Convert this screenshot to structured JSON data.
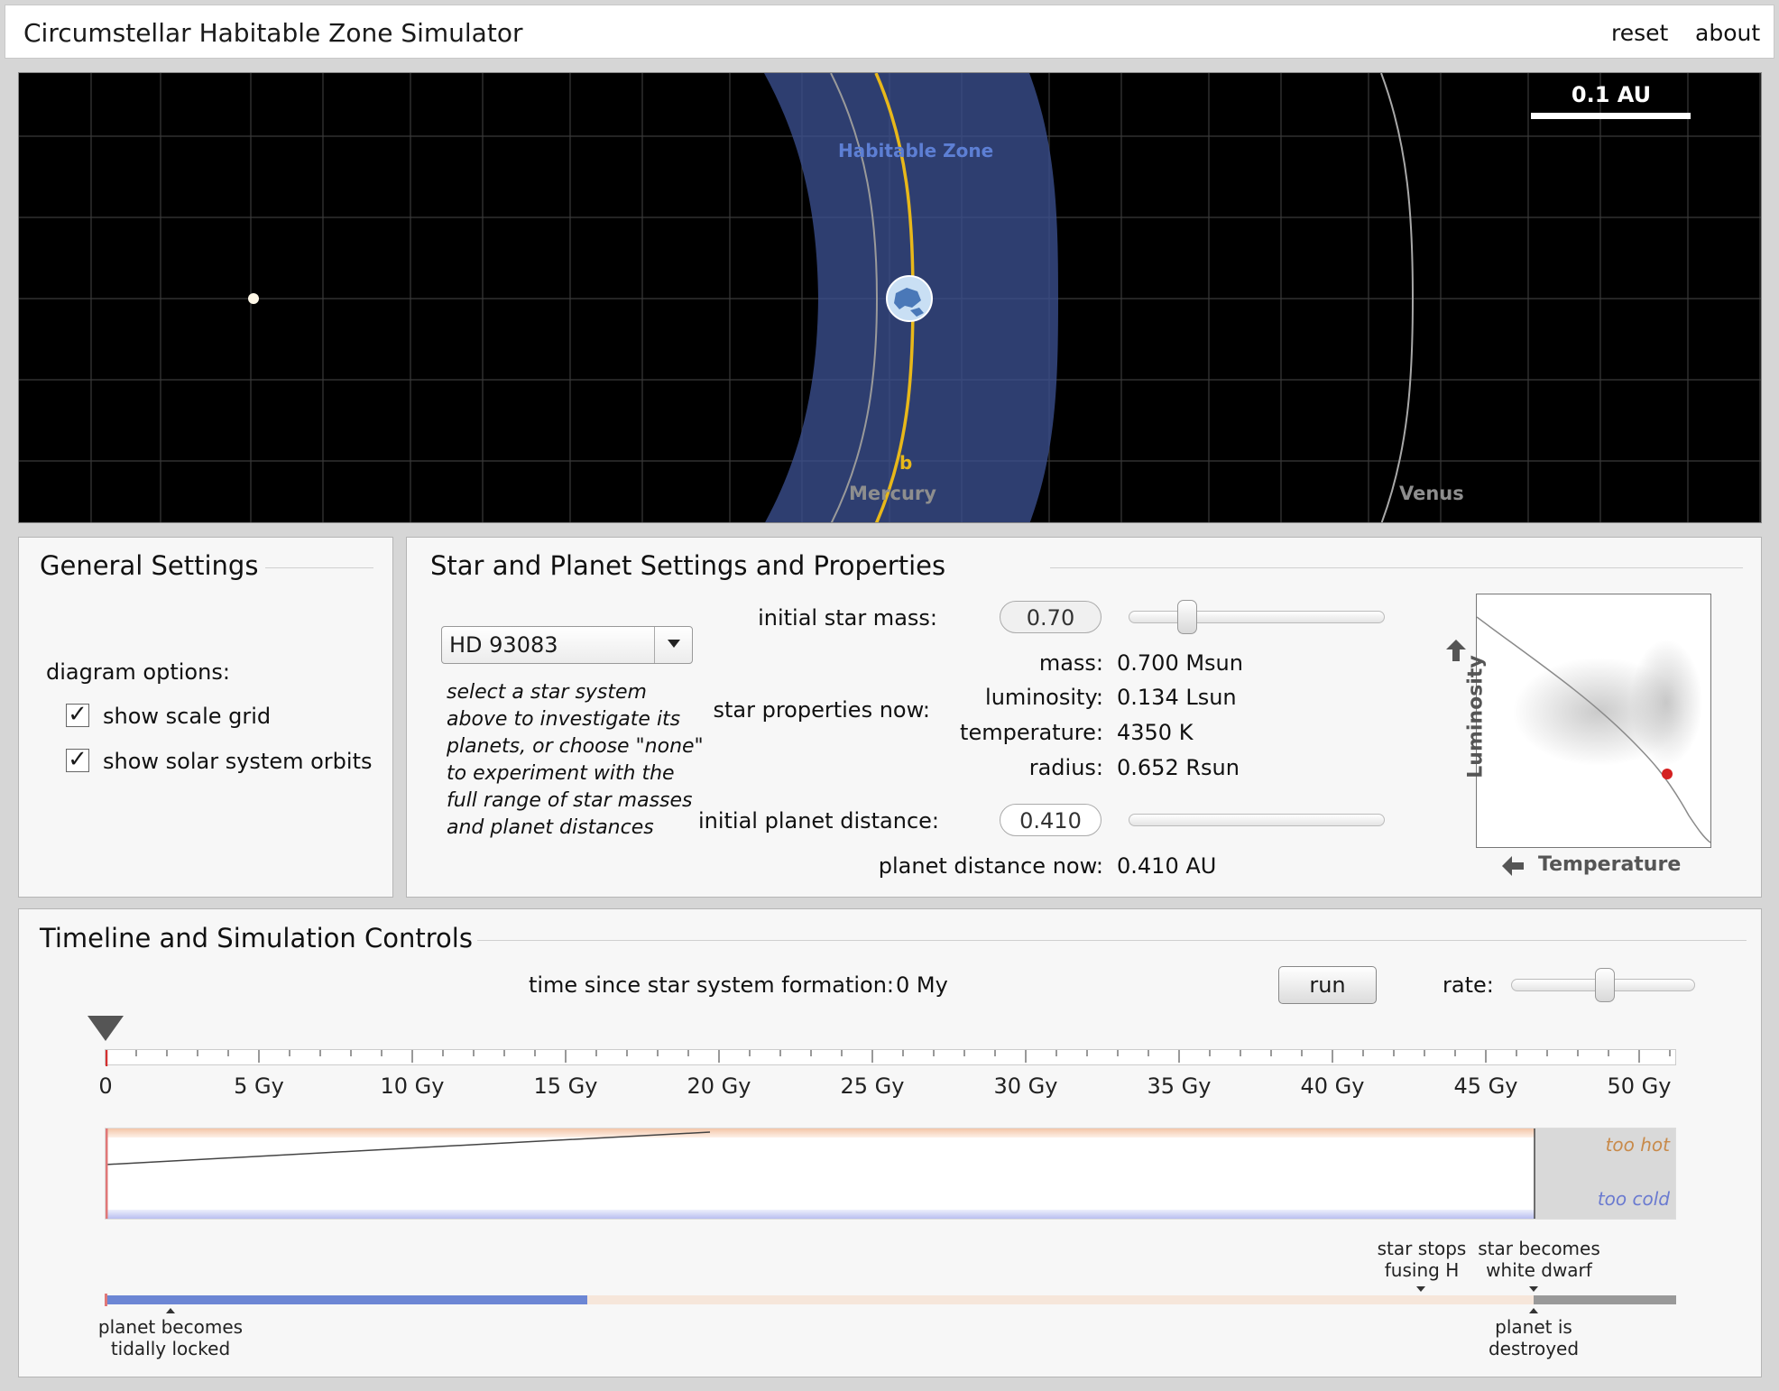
{
  "header": {
    "title": "Circumstellar Habitable Zone Simulator",
    "reset_label": "reset",
    "about_label": "about"
  },
  "orbit_view": {
    "scale_label": "0.1 AU",
    "habitable_zone_label": "Habitable Zone",
    "planet_label": "b",
    "mercury_label": "Mercury",
    "venus_label": "Venus",
    "colors": {
      "background": "#000000",
      "habitable_zone": "#3b4f8f",
      "planet_orbit": "#e8b81a",
      "solar_orbits": "#9a9a9a",
      "grid": "#333333"
    }
  },
  "general_settings": {
    "title": "General Settings",
    "diagram_options_label": "diagram options:",
    "show_scale_grid": {
      "label": "show scale grid",
      "checked": true
    },
    "show_solar_orbits": {
      "label": "show solar system orbits",
      "checked": true
    }
  },
  "star_planet": {
    "title": "Star and Planet Settings and Properties",
    "system_select": {
      "value": "HD 93083"
    },
    "help_lines": [
      "select a star system",
      "above to investigate its",
      "planets, or choose \"none\"",
      "to experiment with the",
      "full range of star masses",
      "and planet distances"
    ],
    "initial_star_mass_label": "initial star mass:",
    "initial_star_mass_value": "0.70",
    "star_mass_slider_fraction": 0.25,
    "star_properties_label": "star properties now:",
    "properties": [
      {
        "key": "mass:",
        "value": "0.700 Msun"
      },
      {
        "key": "luminosity:",
        "value": "0.134 Lsun"
      },
      {
        "key": "temperature:",
        "value": "4350 K"
      },
      {
        "key": "radius:",
        "value": "0.652 Rsun"
      }
    ],
    "initial_planet_distance_label": "initial planet distance:",
    "initial_planet_distance_value": "0.410",
    "planet_distance_now_label": "planet distance now:",
    "planet_distance_now_value": "0.410 AU",
    "hr_diagram": {
      "y_label": "Luminosity",
      "x_label": "Temperature"
    }
  },
  "timeline": {
    "title": "Timeline and Simulation Controls",
    "time_label": "time since star system formation:",
    "time_value": "0 My",
    "run_label": "run",
    "rate_label": "rate:",
    "rate_slider_fraction": 0.58,
    "ticks": [
      "0",
      "5 Gy",
      "10 Gy",
      "15 Gy",
      "20 Gy",
      "25 Gy",
      "30 Gy",
      "35 Gy",
      "40 Gy",
      "45 Gy",
      "50 Gy"
    ],
    "too_hot_label": "too hot",
    "too_cold_label": "too cold",
    "events": {
      "star_stops_fusing": [
        "star stops",
        "fusing H"
      ],
      "white_dwarf": [
        "star becomes",
        "white dwarf"
      ],
      "tidally_locked": [
        "planet becomes",
        "tidally locked"
      ],
      "destroyed": [
        "planet is",
        "destroyed"
      ]
    }
  }
}
